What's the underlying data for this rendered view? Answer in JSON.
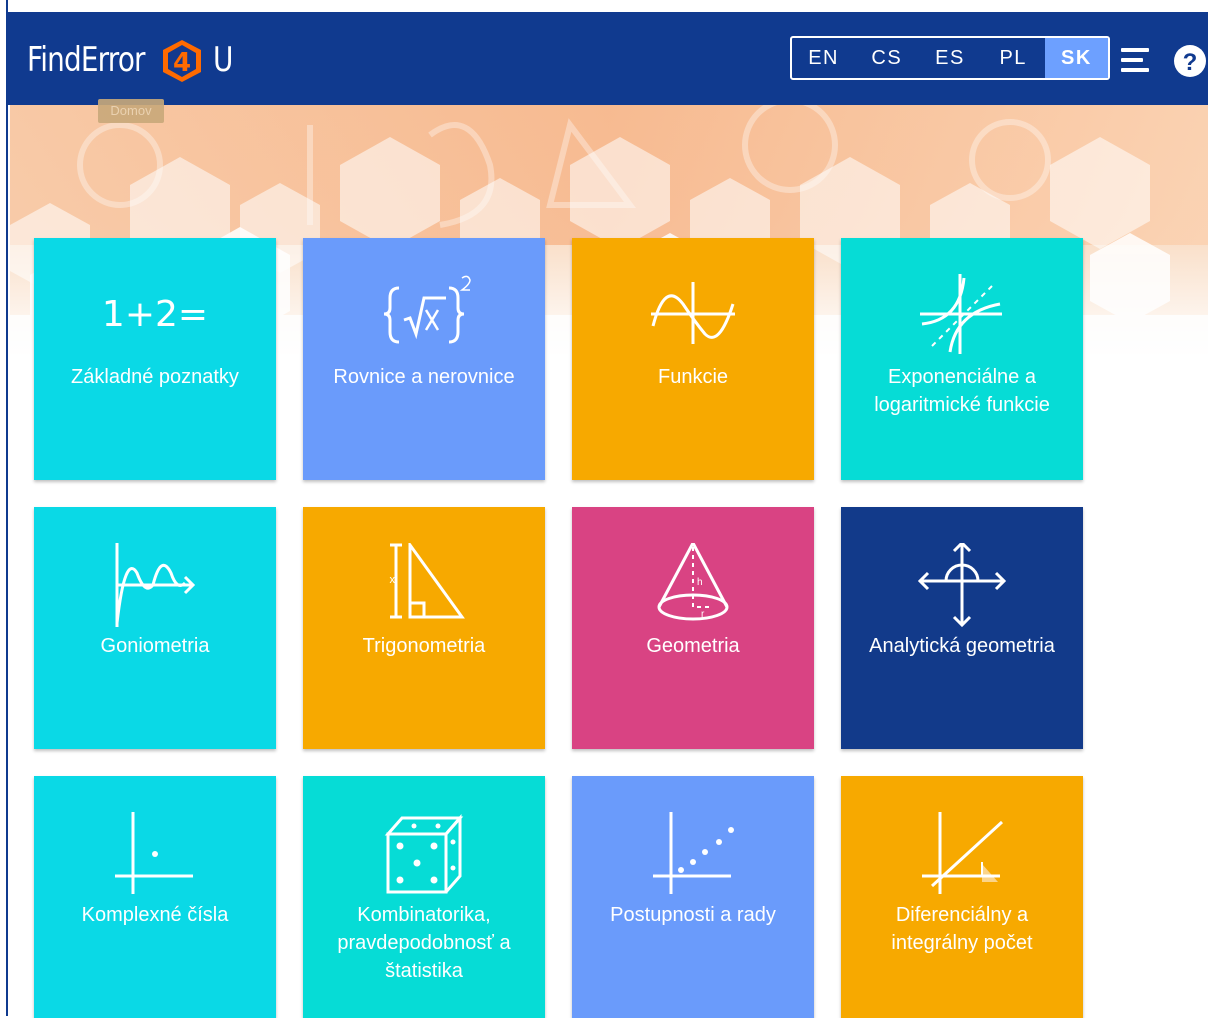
{
  "header": {
    "logo_text": "FindError",
    "logo_number": "4",
    "logo_suffix": "U",
    "languages": [
      "EN",
      "CS",
      "ES",
      "PL",
      "SK"
    ],
    "active_language": "SK",
    "menu_icon": "hamburger-menu-icon",
    "help_icon": "question-circle-icon"
  },
  "tooltip": "Domov",
  "colors": {
    "header": "#103a8f",
    "cyan": "#0ad9e6",
    "turquoise": "#06dcd6",
    "blue": "#6a9bfb",
    "orange": "#f7a900",
    "pink": "#d94383",
    "navy": "#123a8a",
    "active_language": "#6da0ff"
  },
  "tiles": [
    {
      "label": "Základné poznatky",
      "icon": "1+2=",
      "color": "cyan"
    },
    {
      "label": "Rovnice a nerovnice",
      "icon": "root-braces-icon",
      "color": "blue"
    },
    {
      "label": "Funkcie",
      "icon": "sine-function-icon",
      "color": "orange"
    },
    {
      "label": "Exponenciálne a logaritmické funkcie",
      "icon": "exp-log-graph-icon",
      "color": "turquoise"
    },
    {
      "label": "Goniometria",
      "icon": "wave-arrow-icon",
      "color": "cyan"
    },
    {
      "label": "Trigonometria",
      "icon": "triangle-icon",
      "color": "orange"
    },
    {
      "label": "Geometria",
      "icon": "cone-icon",
      "color": "pink"
    },
    {
      "label": "Analytická geometria",
      "icon": "axes-circle-icon",
      "color": "navy"
    },
    {
      "label": "Komplexné čísla",
      "icon": "complex-plane-icon",
      "color": "cyan"
    },
    {
      "label": "Kombinatorika, pravdepodobnosť a štatistika",
      "icon": "dice-icon",
      "color": "turquoise"
    },
    {
      "label": "Postupnosti a rady",
      "icon": "sequence-dots-icon",
      "color": "blue"
    },
    {
      "label": "Diferenciálny a integrálny počet",
      "icon": "integral-area-icon",
      "color": "orange"
    }
  ]
}
